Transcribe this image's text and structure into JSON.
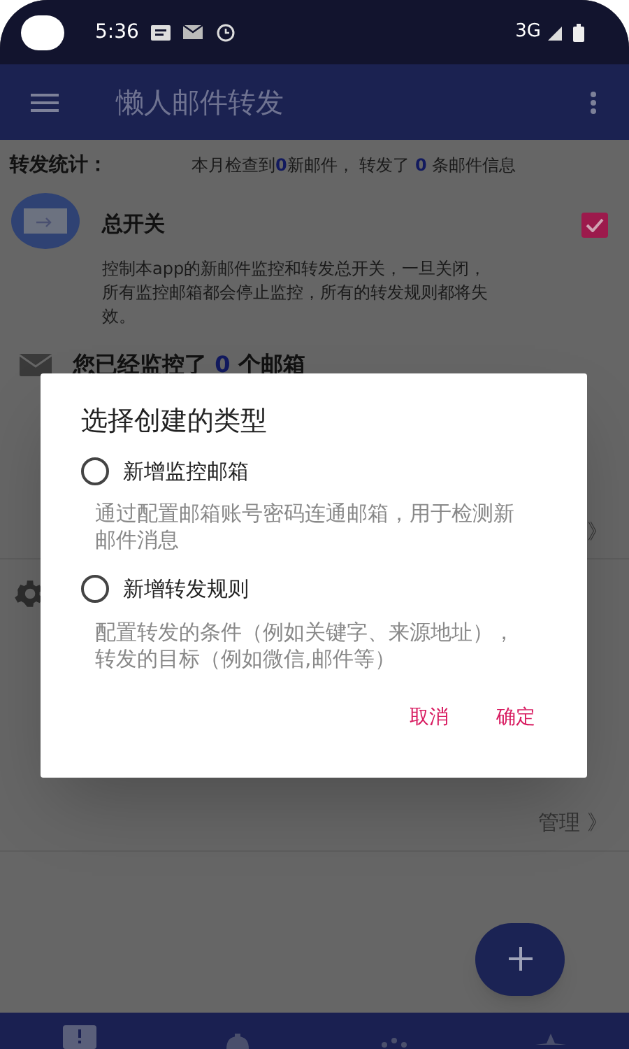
{
  "status_bar": {
    "time": "5:36",
    "network": "3G"
  },
  "app_bar": {
    "title": "懒人邮件转发"
  },
  "stats": {
    "label": "转发统计：",
    "text": "本月检查到**0**新邮件， 转发了 **0** 条邮件信息"
  },
  "master_switch": {
    "title": "总开关",
    "checked": true,
    "description": "控制本app的新邮件监控和转发总开关，一旦关闭，所有监控邮箱都会停止监控，所有的转发规则都将失效。"
  },
  "mailbox_summary": {
    "text": "您已经监控了 **0** 个邮箱",
    "link": "》"
  },
  "rules_summary": {
    "link": "管理 》"
  },
  "dialog": {
    "title": "选择创建的类型",
    "options": [
      {
        "label": "新增监控邮箱",
        "description": "通过配置邮箱账号密码连通邮箱，用于检测新邮件消息",
        "selected": false
      },
      {
        "label": "新增转发规则",
        "description": "配置转发的条件（例如关键字、来源地址），转发的目标（例如微信,邮件等）",
        "selected": false
      }
    ],
    "buttons": [
      "取消",
      "确定"
    ]
  }
}
